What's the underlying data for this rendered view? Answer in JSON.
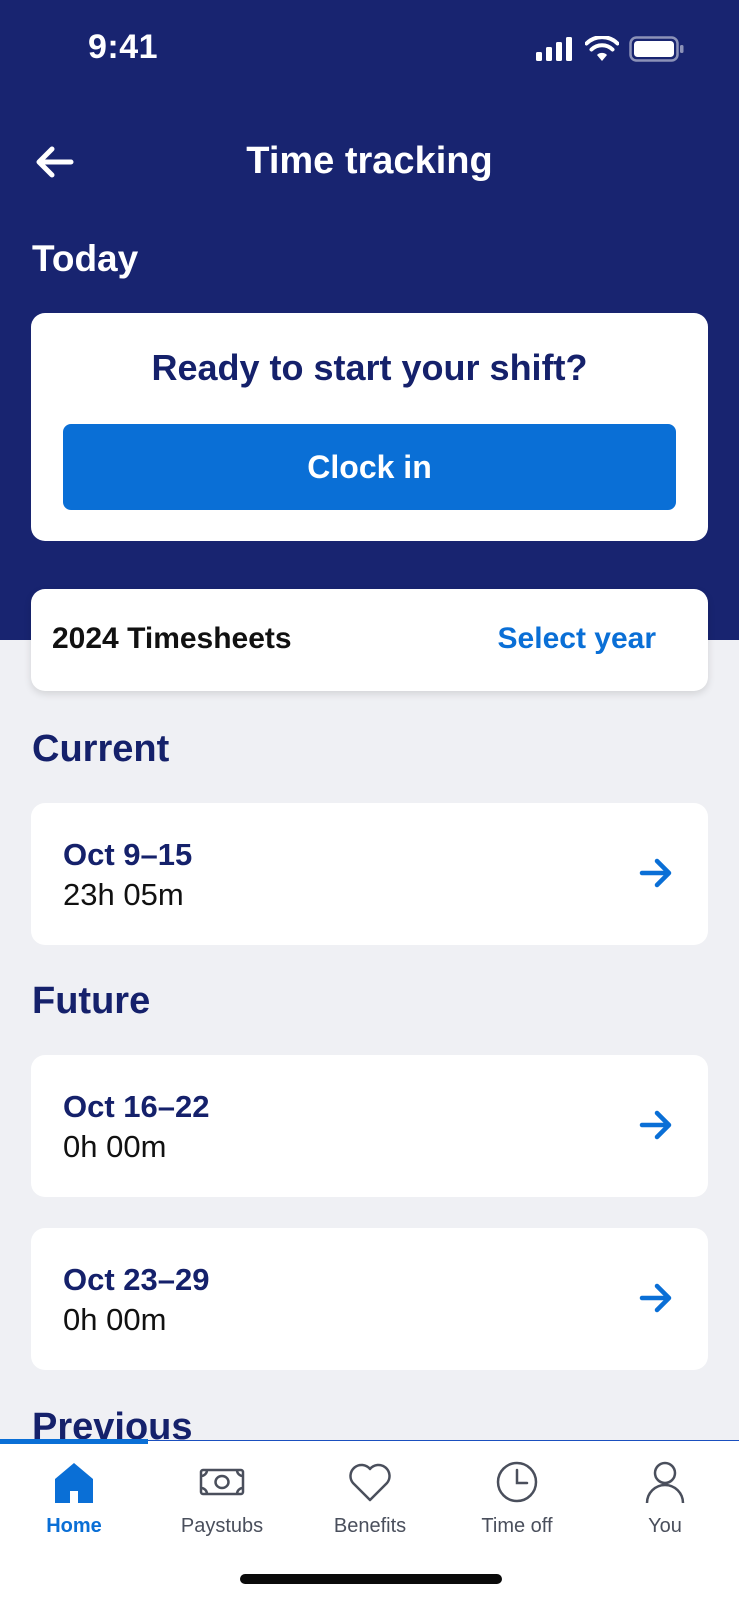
{
  "status_bar": {
    "time": "9:41"
  },
  "header": {
    "title": "Time tracking",
    "back_icon": "arrow-left-icon"
  },
  "today": {
    "heading": "Today",
    "prompt": "Ready to start your shift?",
    "clock_in_label": "Clock in"
  },
  "timesheets": {
    "title": "2024 Timesheets",
    "select_year_label": "Select year"
  },
  "sections": {
    "current": "Current",
    "future": "Future",
    "previous": "Previous"
  },
  "periods": {
    "current": [
      {
        "date": "Oct 9–15",
        "hours": "23h 05m"
      }
    ],
    "future": [
      {
        "date": "Oct 16–22",
        "hours": "0h 00m"
      },
      {
        "date": "Oct 23–29",
        "hours": "0h 00m"
      }
    ]
  },
  "tabs": [
    {
      "label": "Home",
      "icon": "home-icon",
      "active": true
    },
    {
      "label": "Paystubs",
      "icon": "money-icon",
      "active": false
    },
    {
      "label": "Benefits",
      "icon": "heart-icon",
      "active": false
    },
    {
      "label": "Time off",
      "icon": "clock-icon",
      "active": false
    },
    {
      "label": "You",
      "icon": "person-icon",
      "active": false
    }
  ],
  "colors": {
    "header_bg": "#182470",
    "accent": "#0a6fd6",
    "page_bg": "#eff0f4",
    "heading_text": "#15216b"
  }
}
